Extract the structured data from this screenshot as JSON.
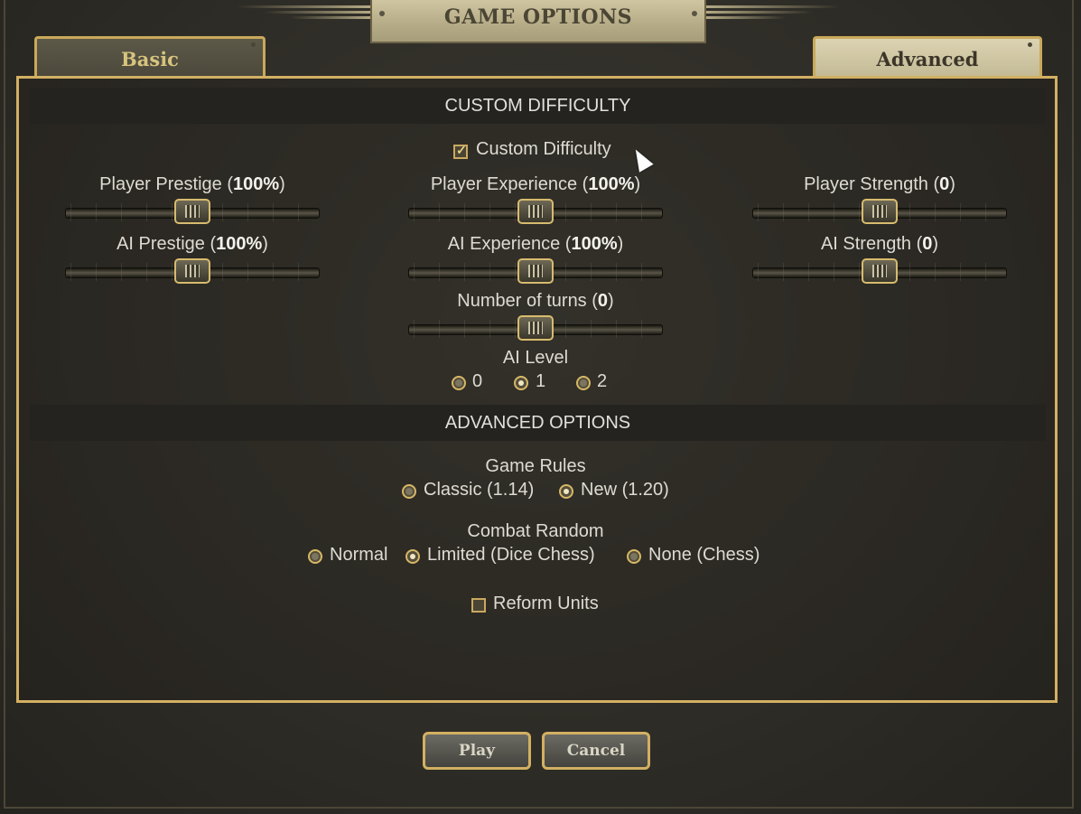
{
  "window": {
    "title": "GAME OPTIONS"
  },
  "tabs": [
    {
      "label": "Basic",
      "active": false
    },
    {
      "label": "Advanced",
      "active": true
    }
  ],
  "custom_difficulty": {
    "heading": "CUSTOM DIFFICULTY",
    "checkbox_label": "Custom Difficulty",
    "checked": true,
    "sliders": {
      "player_prestige": {
        "label": "Player Prestige",
        "value": "100%"
      },
      "player_experience": {
        "label": "Player Experience",
        "value": "100%"
      },
      "player_strength": {
        "label": "Player Strength",
        "value": "0"
      },
      "ai_prestige": {
        "label": "AI Prestige",
        "value": "100%"
      },
      "ai_experience": {
        "label": "AI Experience",
        "value": "100%"
      },
      "ai_strength": {
        "label": "AI Strength",
        "value": "0"
      },
      "number_of_turns": {
        "label": "Number of turns",
        "value": "0"
      }
    },
    "ai_level": {
      "label": "AI Level",
      "options": [
        "0",
        "1",
        "2"
      ],
      "selected": "1"
    }
  },
  "advanced_options": {
    "heading": "ADVANCED OPTIONS",
    "game_rules": {
      "label": "Game Rules",
      "options": [
        "Classic (1.14)",
        "New (1.20)"
      ],
      "selected": "New (1.20)"
    },
    "combat_random": {
      "label": "Combat Random",
      "options": [
        "Normal",
        "Limited (Dice Chess)",
        "None (Chess)"
      ],
      "selected": "Limited (Dice Chess)"
    },
    "reform_units": {
      "label": "Reform Units",
      "checked": false
    }
  },
  "buttons": {
    "play": "Play",
    "cancel": "Cancel"
  },
  "colors": {
    "accent": "#d2b063",
    "panel_bg": "#2e2c26",
    "text": "#dedbd2"
  }
}
